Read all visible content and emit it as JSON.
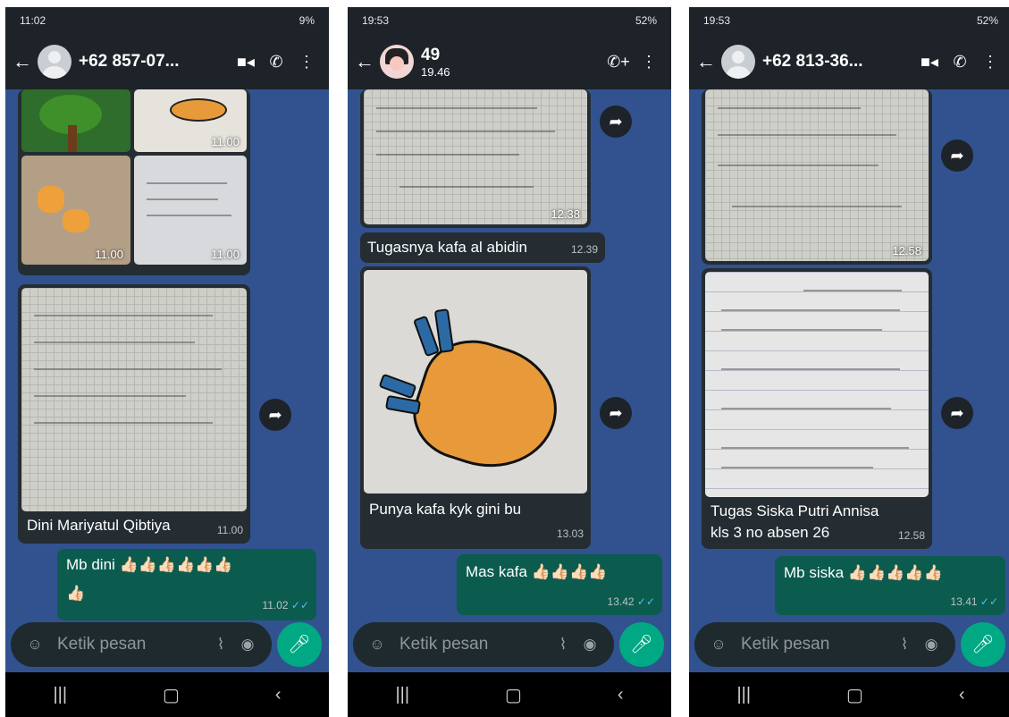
{
  "phones": [
    {
      "status_time": "11:02",
      "status_battery": "9%",
      "contact": "+62 857-07...",
      "image_times": [
        "11.00",
        "11.00",
        "11.00"
      ],
      "caption": "Dini Mariyatul Qibtiya",
      "caption_time": "11.00",
      "out_text": "Mb dini 👍🏻👍🏻👍🏻👍🏻👍🏻👍🏻",
      "out_text2": "👍🏻",
      "out_time": "11.02"
    },
    {
      "status_time": "19:53",
      "status_battery": "52%",
      "contact": "49",
      "contact_sub": "19.46",
      "image1_time": "12.38",
      "caption1": "Tugasnya kafa al abidin",
      "caption1_time": "12.39",
      "caption2": "Punya kafa kyk gini bu",
      "caption2_time": "13.03",
      "out_text": "Mas kafa 👍🏻👍🏻👍🏻👍🏻",
      "out_time": "13.42"
    },
    {
      "status_time": "19:53",
      "status_battery": "52%",
      "contact": "+62 813-36...",
      "image1_time": "12.58",
      "caption_line1": "Tugas Siska Putri Annisa",
      "caption_line2": "kls 3 no absen 26",
      "caption_time": "12.58",
      "out_text": "Mb siska 👍🏻👍🏻👍🏻👍🏻👍🏻",
      "out_time": "13.41"
    }
  ],
  "input_placeholder": "Ketik pesan",
  "icons": [
    "back-arrow",
    "video-call",
    "phone-call",
    "add-call",
    "more-vert",
    "forward",
    "emoji",
    "attach",
    "camera",
    "mic",
    "nav-recents",
    "nav-home",
    "nav-back"
  ]
}
